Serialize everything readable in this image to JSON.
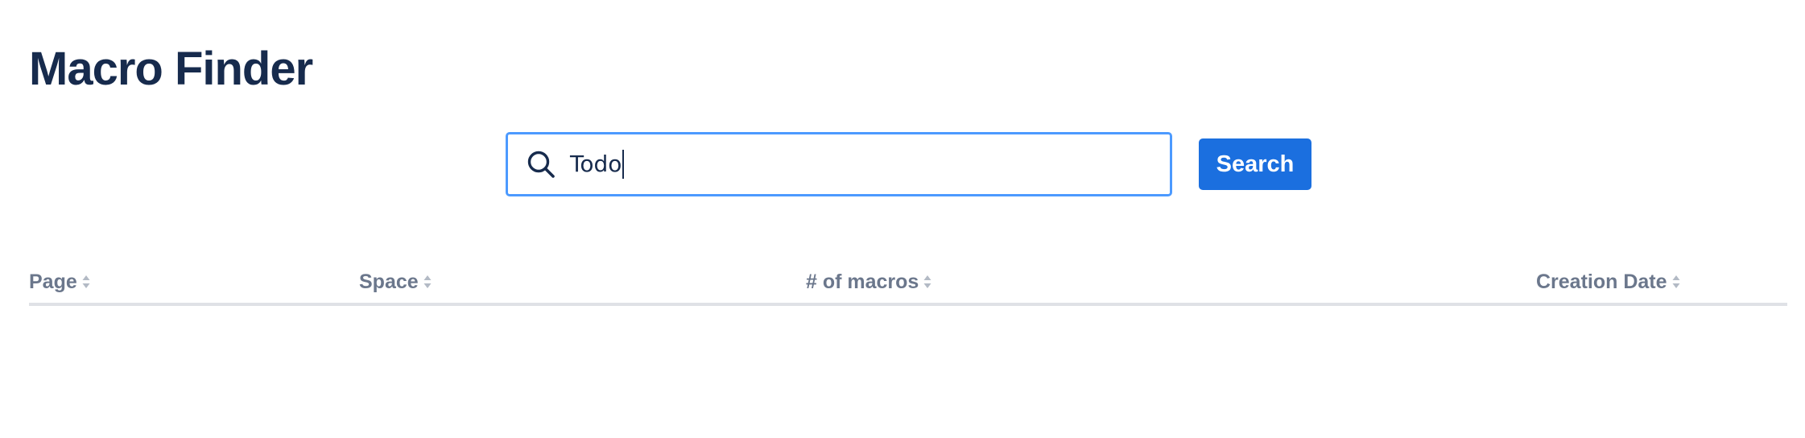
{
  "page": {
    "title": "Macro Finder"
  },
  "search": {
    "value": "Todo",
    "icon": "search-icon",
    "button_label": "Search",
    "focus_color": "#4c9aff",
    "button_color": "#1b6fdf"
  },
  "table": {
    "columns": [
      {
        "label": "Page",
        "sort_icon": "sort-icon"
      },
      {
        "label": "Space",
        "sort_icon": "sort-icon"
      },
      {
        "label": "# of macros",
        "sort_icon": "sort-icon"
      },
      {
        "label": "Creation Date",
        "sort_icon": "sort-icon"
      }
    ],
    "rows": []
  }
}
